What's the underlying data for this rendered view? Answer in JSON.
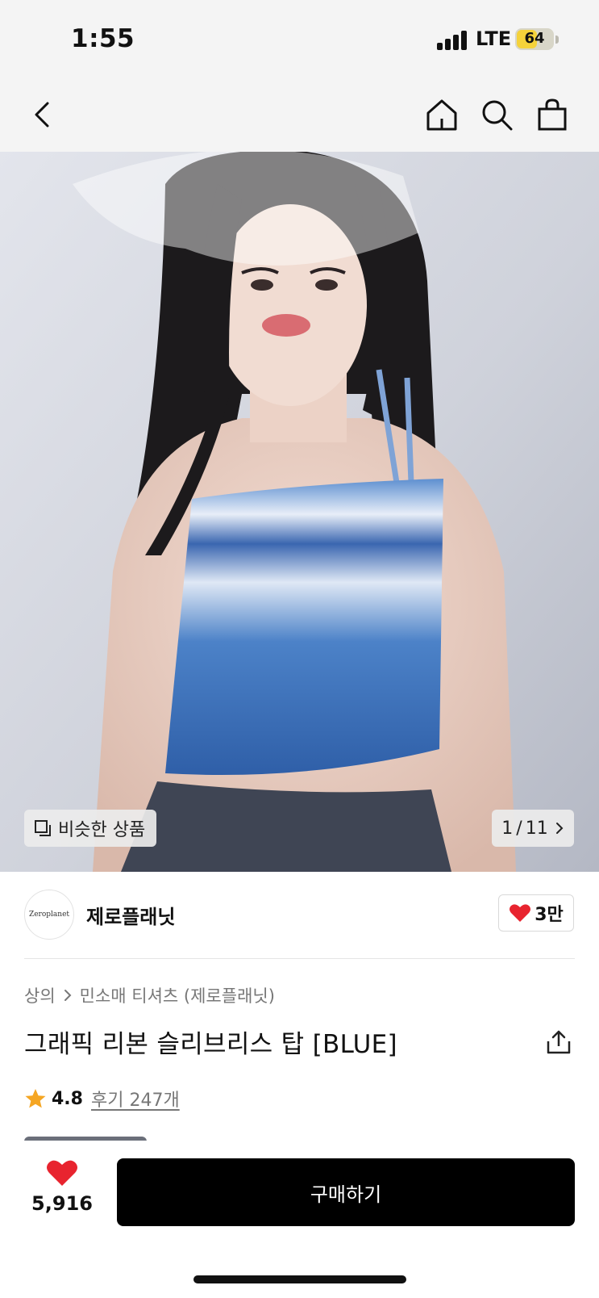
{
  "status_bar": {
    "time": "1:55",
    "network": "LTE",
    "battery": "64"
  },
  "gallery": {
    "similar_label": "비슷한 상품",
    "page_current": "1",
    "page_total": "11",
    "page_separator": "/"
  },
  "brand": {
    "logo_text": "Zeroplanet",
    "name": "제로플래닛",
    "likes": "3만"
  },
  "product": {
    "category": "상의",
    "subcategory": "민소매 티셔츠 (제로플래닛)",
    "title": "그래픽 리본 슬리브리스 탑 [BLUE]",
    "rating": "4.8",
    "reviews": "후기 247개"
  },
  "bottom_bar": {
    "like_count": "5,916",
    "buy_label": "구매하기"
  },
  "colors": {
    "accent_red": "#e8242f",
    "star": "#f5a623",
    "buy_button": "#000000"
  },
  "icons": [
    "back-icon",
    "home-icon",
    "search-icon",
    "bag-icon",
    "similar-icon",
    "chevron-right-icon",
    "heart-icon",
    "share-icon",
    "star-icon"
  ]
}
